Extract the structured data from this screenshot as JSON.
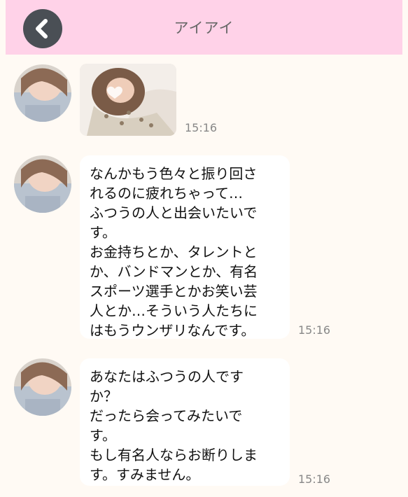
{
  "header": {
    "title": "アイアイ",
    "back_icon": "chevron-left-icon"
  },
  "colors": {
    "header_bg": "#ffd2e8",
    "back_button": "#4a4f55",
    "chat_bg": "#fffaf4",
    "bubble_bg": "#ffffff"
  },
  "messages": [
    {
      "type": "image",
      "time": "15:16"
    },
    {
      "type": "text",
      "text": "なんかもう色々と振り回さ\nれるのに疲れちゃって…\nふつうの人と出会いたいで\nす。\nお金持ちとか、タレントと\nか、バンドマンとか、有名\nスポーツ選手とかお笑い芸\n人とか…そういう人たちに\nはもうウンザリなんです。",
      "time": "15:16"
    },
    {
      "type": "text",
      "text": "あなたはふつうの人です\nか？\nだったら会ってみたいで\nす。\nもし有名人ならお断りしま\nす。すみません。",
      "time": "15:16"
    }
  ]
}
